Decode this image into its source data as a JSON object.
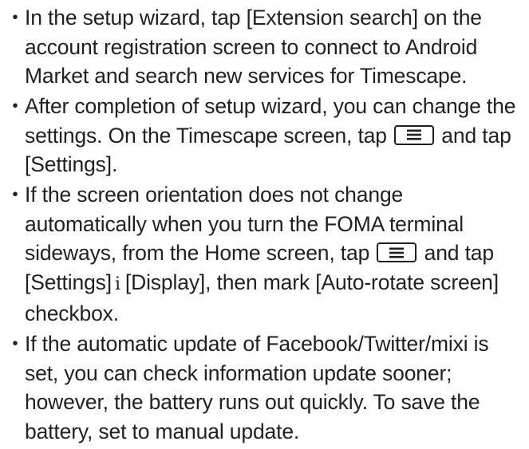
{
  "bullets": {
    "marker": "・",
    "item1": {
      "text": "In the setup wizard, tap [Extension search] on the account registration screen to connect to Android Market and search new services for Timescape."
    },
    "item2": {
      "text_before": "After completion of setup wizard, you can change the settings. On the Timescape screen, tap ",
      "text_after": " and tap [Settings]."
    },
    "item3": {
      "text_before": "If the screen orientation does not change automatically when you turn the FOMA terminal sideways, from the Home screen, tap ",
      "text_middle": " and tap [Settings]",
      "arrow": "i",
      "text_after": "[Display], then mark [Auto-rotate screen] checkbox."
    },
    "item4": {
      "text": "If the automatic update of Facebook/Twitter/mixi is set, you can check information update sooner; however, the battery runs out quickly. To save the battery, set to manual update."
    }
  },
  "icons": {
    "menu_key": "menu-key-icon"
  },
  "colors": {
    "text": "#231f20",
    "background": "#ffffff"
  }
}
